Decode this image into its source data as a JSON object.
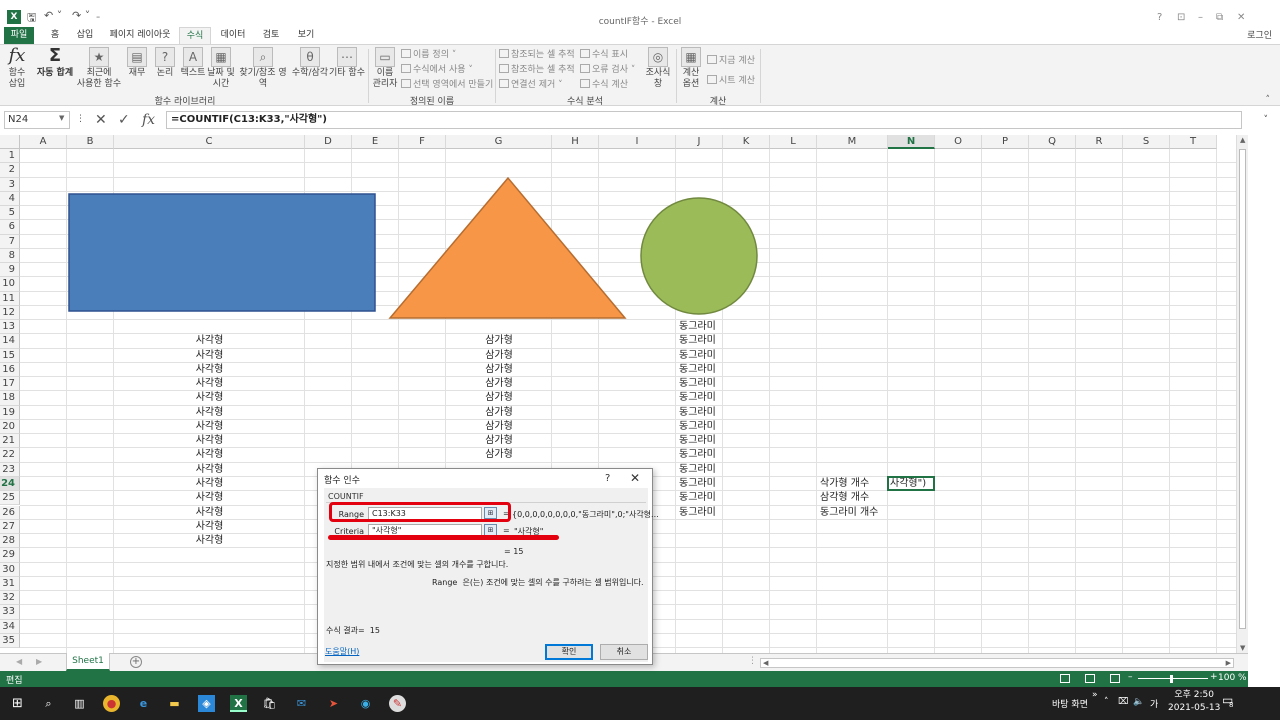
{
  "window": {
    "title": "countIF함수 - Excel",
    "login": "로그인",
    "help_icon": "?",
    "controls": [
      "restore-ribbon-icon",
      "minimize-icon",
      "maximize-icon",
      "close-icon"
    ]
  },
  "ribbon_tabs": [
    "파일",
    "홈",
    "삽입",
    "페이지 레이아웃",
    "수식",
    "데이터",
    "검토",
    "보기"
  ],
  "active_tab": "수식",
  "ribbon": {
    "buttons": [
      {
        "label": "함수\n삽입",
        "icon": "fx-icon"
      },
      {
        "label": "자동 합계",
        "icon": "sigma-icon"
      },
      {
        "label": "최근에\n사용한 함수",
        "icon": "star-icon"
      },
      {
        "label": "재무",
        "icon": "book-icon"
      },
      {
        "label": "논리",
        "icon": "question-icon"
      },
      {
        "label": "텍스트",
        "icon": "text-icon"
      },
      {
        "label": "날짜 및\n시간",
        "icon": "calendar-icon"
      },
      {
        "label": "찾기/참조 영역",
        "icon": "search-icon"
      },
      {
        "label": "수학/삼각",
        "icon": "theta-icon"
      },
      {
        "label": "기타 함수",
        "icon": "more-icon"
      },
      {
        "label": "이름\n관리자",
        "icon": "name-manager-icon"
      },
      {
        "label": "조사식\n창",
        "icon": "watch-icon"
      },
      {
        "label": "계산\n옵션",
        "icon": "calculator-icon"
      }
    ],
    "small_buttons": {
      "define_name": "이름 정의",
      "use_in_formula": "수식에서 사용",
      "create_from_selection": "선택 영역에서 만들기",
      "trace_precedents": "참조되는 셀 추적",
      "trace_dependents": "참조하는 셀 추적",
      "remove_arrows": "연결선 제거",
      "show_formulas": "수식 표시",
      "error_checking": "오류 검사",
      "evaluate_formula": "수식 계산",
      "calc_now": "지금 계산",
      "calc_sheet": "시트 계산"
    },
    "groups": [
      "함수 라이브러리",
      "정의된 이름",
      "수식 분석",
      "계산"
    ]
  },
  "formula_bar": {
    "name_box": "N24",
    "formula": "=COUNTIF(C13:K33,\"사각형\")"
  },
  "columns": [
    "A",
    "B",
    "C",
    "D",
    "E",
    "F",
    "G",
    "H",
    "I",
    "J",
    "K",
    "L",
    "M",
    "N",
    "O",
    "P",
    "Q",
    "R",
    "S",
    "T"
  ],
  "rows": [
    "1",
    "2",
    "3",
    "4",
    "5",
    "6",
    "7",
    "8",
    "9",
    "10",
    "11",
    "12",
    "13",
    "14",
    "15",
    "16",
    "17",
    "18",
    "19",
    "20",
    "21",
    "22",
    "23",
    "24",
    "25",
    "26",
    "27",
    "28",
    "29",
    "30",
    "31",
    "32",
    "33",
    "34",
    "35"
  ],
  "selected_column": "N",
  "selected_row": "24",
  "cells": {
    "col_c": [
      "사각형",
      "사각형",
      "사각형",
      "사각형",
      "사각형",
      "사각형",
      "사각형",
      "사각형",
      "사각형",
      "사각형",
      "사각형",
      "사각형",
      "사각형",
      "사각형",
      "사각형"
    ],
    "col_g": [
      "삼가형",
      "삼가형",
      "삼가형",
      "삼가형",
      "삼가형",
      "삼가형",
      "삼가형",
      "삼가형",
      "삼가형"
    ],
    "col_j": [
      "동그라미",
      "동그라미",
      "동그라미",
      "동그라미",
      "동그라미",
      "동그라미",
      "동그라미",
      "동그라미",
      "동그라미",
      "동그라미",
      "동그라미",
      "동그라미",
      "동그라미",
      "동그라미"
    ],
    "labels": [
      "삭가형 개수",
      "삼각형 개수",
      "동그라미 개수"
    ],
    "active_cell_text": "사각형\")"
  },
  "shapes": {
    "rectangle_color": "#4a7ebb",
    "triangle_color": "#f79646",
    "circle_color": "#9bbb59"
  },
  "sheet_tabs": [
    "Sheet1"
  ],
  "status": {
    "mode": "편집",
    "zoom": "100 %"
  },
  "dialog": {
    "title": "함수 인수",
    "help": "?",
    "function_name": "COUNTIF",
    "args": [
      {
        "label": "Range",
        "value": "C13:K33",
        "result": "{0,0,0,0,0,0,0,0,\"동그라미\",0;\"사각형..."
      },
      {
        "label": "Criteria",
        "value": "\"사각형\"",
        "result": "\"사각형\""
      }
    ],
    "overall_result": "=  15",
    "description": "지정한 범위 내에서 조건에 맞는 셀의 개수를 구합니다.",
    "arg_help_name": "Range",
    "arg_help": "은(는) 조건에 맞는 셀의 수를 구하려는 셀 범위입니다.",
    "formula_result_label": "수식 결과=",
    "formula_result_value": "15",
    "help_link": "도움말(H)",
    "ok": "확인",
    "cancel": "취소"
  },
  "taskbar": {
    "desktop": "바탕 화면",
    "tray_chevron": "˄",
    "ime": "가",
    "time": "오후 2:50",
    "date": "2021-05-13",
    "notification_count": "8"
  }
}
